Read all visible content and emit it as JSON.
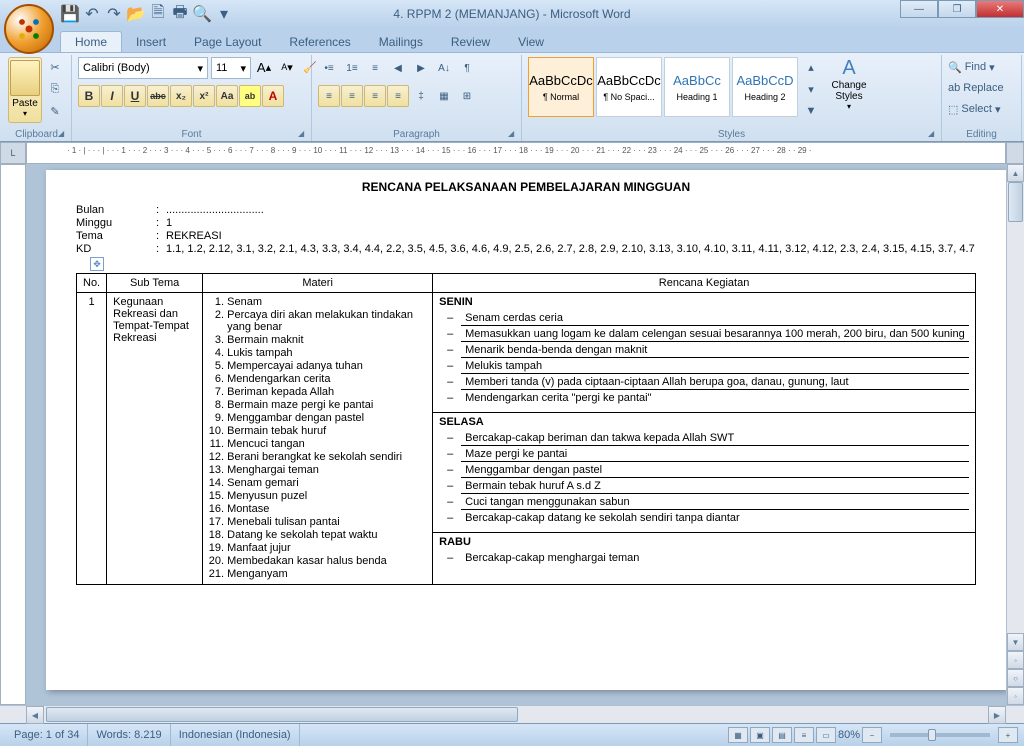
{
  "window": {
    "title": "4. RPPM 2 (MEMANJANG) - Microsoft Word"
  },
  "qat_icons": [
    "save",
    "undo",
    "redo",
    "open",
    "new",
    "print",
    "preview",
    "dd"
  ],
  "win_controls": {
    "min": "—",
    "max": "❐",
    "close": "✕"
  },
  "tabs": [
    "Home",
    "Insert",
    "Page Layout",
    "References",
    "Mailings",
    "Review",
    "View"
  ],
  "active_tab": "Home",
  "ribbon": {
    "clipboard": {
      "label": "Clipboard",
      "paste": "Paste",
      "cut": "✂",
      "copy": "⎘",
      "fmt": "✎"
    },
    "font": {
      "label": "Font",
      "name": "Calibri (Body)",
      "size": "11",
      "grow": "A",
      "shrink": "A",
      "clear": "Aa",
      "case": "Aa",
      "bold": "B",
      "italic": "I",
      "underline": "U",
      "strike": "abc",
      "sub": "x₂",
      "sup": "x²",
      "case2": "Aa",
      "hl": "ab",
      "color": "A"
    },
    "paragraph": {
      "label": "Paragraph",
      "bullets": "•≡",
      "numbers": "1≡",
      "multi": "≡",
      "dec": "◀",
      "inc": "▶",
      "sort": "A↓",
      "show": "¶",
      "left": "≡",
      "center": "≡",
      "right": "≡",
      "just": "≡",
      "spacing": "‡",
      "shade": "▦",
      "border": "⊞"
    },
    "styles": {
      "label": "Styles",
      "items": [
        {
          "sample": "AaBbCcDc",
          "name": "¶ Normal",
          "sel": true
        },
        {
          "sample": "AaBbCcDc",
          "name": "¶ No Spaci...",
          "sel": false
        },
        {
          "sample": "AaBbCc",
          "name": "Heading 1",
          "sel": false,
          "color": "#2e74b5"
        },
        {
          "sample": "AaBbCcD",
          "name": "Heading 2",
          "sel": false,
          "color": "#2e74b5"
        }
      ],
      "change": "Change Styles"
    },
    "editing": {
      "label": "Editing",
      "find": "Find",
      "replace": "Replace",
      "select": "Select"
    }
  },
  "document": {
    "title": "RENCANA PELAKSANAAN PEMBELAJARAN MINGGUAN",
    "info": [
      {
        "label": "Bulan",
        "value": "................................"
      },
      {
        "label": "Minggu",
        "value": "1"
      },
      {
        "label": "Tema",
        "value": "REKREASI"
      },
      {
        "label": "KD",
        "value": "1.1, 1.2, 2.12, 3.1, 3.2, 2.1, 4.3, 3.3, 3.4, 4.4, 2.2, 3.5, 4.5, 3.6, 4.6, 4.9, 2.5, 2.6, 2.7, 2.8, 2.9, 2.10, 3.13, 3.10, 4.10, 3.11, 4.11, 3.12, 4.12, 2.3, 2.4, 3.15, 4.15, 3.7, 4.7"
      }
    ],
    "table": {
      "headers": [
        "No.",
        "Sub Tema",
        "Materi",
        "Rencana Kegiatan"
      ],
      "row": {
        "no": "1",
        "subtema": "Kegunaan Rekreasi dan Tempat-Tempat Rekreasi",
        "materi": [
          "Senam",
          "Percaya diri akan melakukan tindakan yang benar",
          "Bermain maknit",
          "Lukis tampah",
          "Mempercayai adanya tuhan",
          "Mendengarkan cerita",
          "Beriman kepada Allah",
          "Bermain maze pergi ke pantai",
          "Menggambar dengan pastel",
          "Bermain tebak huruf",
          "Mencuci tangan",
          "Berani berangkat ke sekolah sendiri",
          "Menghargai teman",
          "Senam gemari",
          "Menyusun puzel",
          "Montase",
          "Menebali tulisan pantai",
          "Datang ke sekolah tepat waktu",
          "Manfaat jujur",
          "Membedakan kasar halus benda",
          "Menganyam"
        ],
        "kegiatan": [
          {
            "day": "SENIN",
            "items": [
              "Senam cerdas ceria",
              "Memasukkan uang logam ke dalam celengan sesuai besarannya 100 merah, 200 biru, dan 500 kuning",
              "Menarik benda-benda dengan maknit",
              "Melukis tampah",
              "Memberi tanda (v) pada ciptaan-ciptaan Allah berupa goa, danau, gunung, laut",
              "Mendengarkan cerita \"pergi ke pantai\""
            ]
          },
          {
            "day": "SELASA",
            "items": [
              "Bercakap-cakap beriman dan takwa kepada Allah SWT",
              "Maze pergi ke pantai",
              "Menggambar dengan pastel",
              "Bermain tebak huruf A s.d Z",
              "Cuci tangan menggunakan sabun",
              "Bercakap-cakap datang ke sekolah sendiri tanpa diantar"
            ]
          },
          {
            "day": "RABU",
            "items": [
              "Bercakap-cakap menghargai teman"
            ]
          }
        ]
      }
    }
  },
  "statusbar": {
    "page": "Page: 1 of 34",
    "words": "Words: 8.219",
    "lang": "Indonesian (Indonesia)",
    "zoom": "80%"
  },
  "ruler_text": "· 1 · | · · · | · · · 1 · · · 2 · · · 3 · · · 4 · · · 5 · · · 6 · · · 7 · · · 8 · · · 9 · · · 10 · · · 11 · · · 12 · · · 13 · · · 14 · · · 15 · · · 16 · · · 17 · · · 18 · · · 19 · · · 20 · · · 21 · · · 22 · · · 23 · · · 24 · · · 25 · · · 26 · · · 27 · · · 28 · · 29 ·"
}
